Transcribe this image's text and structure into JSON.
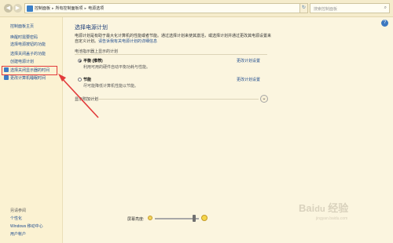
{
  "address_bar": {
    "crumbs": [
      "控制面板",
      "所有控制面板项",
      "电源选项"
    ],
    "search_placeholder": "搜索控制面板"
  },
  "sidebar": {
    "home": "控制面板主页",
    "items": [
      "唤醒时需要密码",
      "选择电源按钮的功能",
      "选择关闭盖子的功能",
      "创建电源计划",
      "选择关闭显示器的时间",
      "更改计算机睡眠时间"
    ],
    "see_also": "另请参阅",
    "footer": [
      "个性化",
      "Windows 移动中心",
      "用户帐户"
    ]
  },
  "main": {
    "title": "选择电源计划",
    "description": "电源计划是有助于最大化计算机的性能或者节能。通过选择计划来使其激活，或选择计划并通过更改其电源设置来自定义计划。",
    "description_link": "请告诉我有关电源计划的详细信息",
    "section_label": "电池指示器上显示的计划",
    "plans": [
      {
        "name": "平衡 (推荐)",
        "desc": "利用可用的硬件自动平衡功耗与性能。",
        "link": "更改计划设置",
        "selected": true
      },
      {
        "name": "节能",
        "desc": "尽可能降低计算机性能以节能。",
        "link": "更改计划设置",
        "selected": false
      }
    ],
    "more_plans": "显示附加计划"
  },
  "brightness": {
    "label": "屏幕亮度:",
    "level": 0.9
  },
  "watermark": {
    "text": "Baidu经验",
    "sub": "jingyan.baidu.com"
  },
  "colors": {
    "highlight": "#e23b3b",
    "link": "#1f4c8f",
    "background": "#fbf5df"
  }
}
